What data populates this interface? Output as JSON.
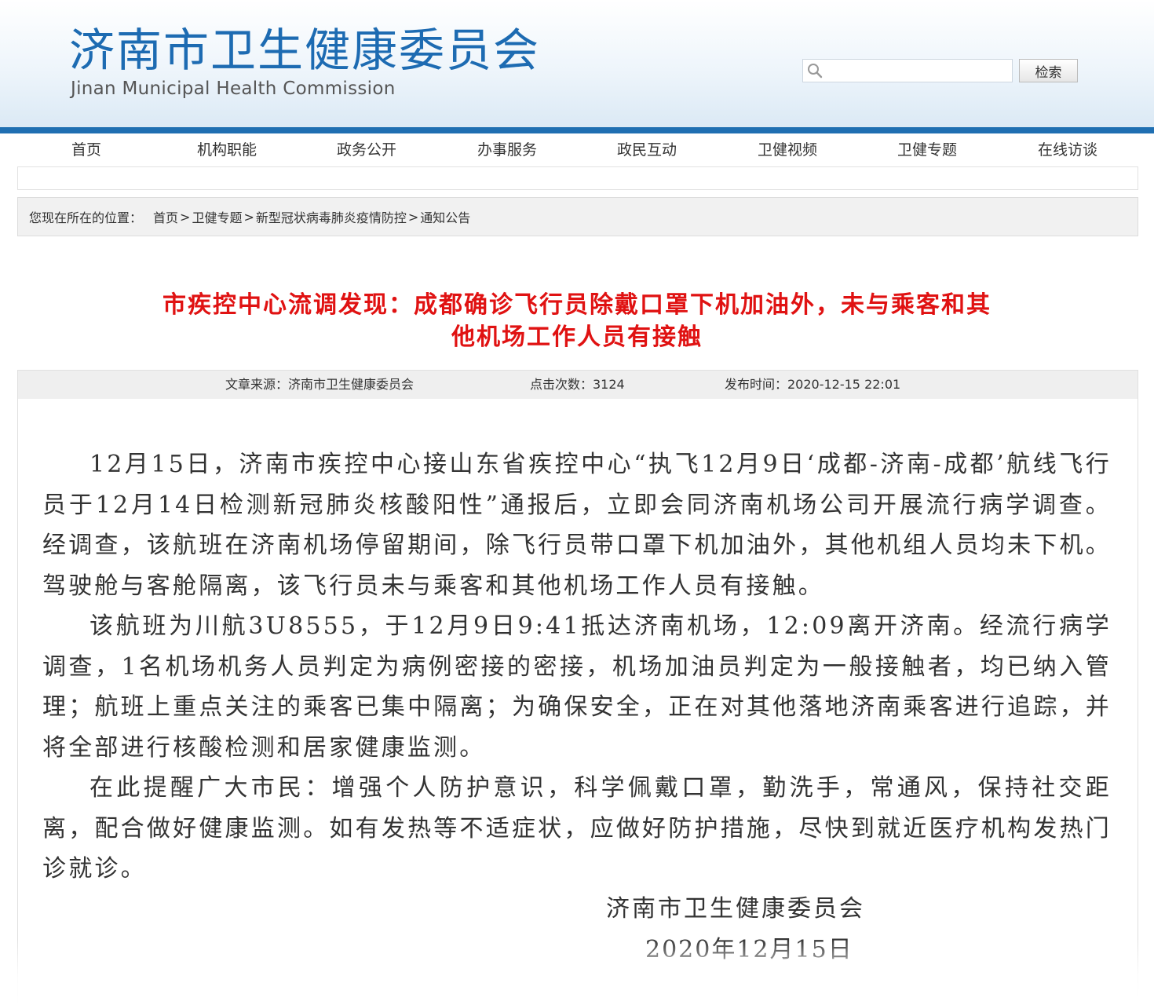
{
  "header": {
    "title_cn": "济南市卫生健康委员会",
    "title_en": "Jinan Municipal Health Commission",
    "search_placeholder": "",
    "search_button": "检索"
  },
  "nav": {
    "items": [
      "首页",
      "机构职能",
      "政务公开",
      "办事服务",
      "政民互动",
      "卫健视频",
      "卫健专题",
      "在线访谈"
    ]
  },
  "breadcrumb": {
    "prefix": "您现在所在的位置：",
    "items": [
      "首页",
      "卫健专题",
      "新型冠状病毒肺炎疫情防控",
      "通知公告"
    ],
    "separator": ">"
  },
  "article": {
    "title_line1": "市疾控中心流调发现：成都确诊飞行员除戴口罩下机加油外，未与乘客和其",
    "title_line2": "他机场工作人员有接触",
    "source": "文章来源：济南市卫生健康委员会",
    "views": "点击次数：3124",
    "published": "发布时间：2020-12-15 22:01",
    "paragraphs": [
      "12月15日，济南市疾控中心接山东省疾控中心“执飞12月9日‘成都-济南-成都’航线飞行员于12月14日检测新冠肺炎核酸阳性”通报后，立即会同济南机场公司开展流行病学调查。经调查，该航班在济南机场停留期间，除飞行员带口罩下机加油外，其他机组人员均未下机。驾驶舱与客舱隔离，该飞行员未与乘客和其他机场工作人员有接触。",
      "该航班为川航3U8555，于12月9日9:41抵达济南机场，12:09离开济南。经流行病学调查，1名机场机务人员判定为病例密接的密接，机场加油员判定为一般接触者，均已纳入管理；航班上重点关注的乘客已集中隔离；为确保安全，正在对其他落地济南乘客进行追踪，并将全部进行核酸检测和居家健康监测。",
      "在此提醒广大市民：增强个人防护意识，科学佩戴口罩，勤洗手，常通风，保持社交距离，配合做好健康监测。如有发热等不适症状，应做好防护措施，尽快到就近医疗机构发热门诊就诊。"
    ],
    "signature": "济南市卫生健康委员会",
    "date": "2020年12月15日"
  },
  "colors": {
    "brand_blue": "#1d6bb2",
    "header_bar": "#1f6fb2",
    "title_red": "#e01212"
  }
}
